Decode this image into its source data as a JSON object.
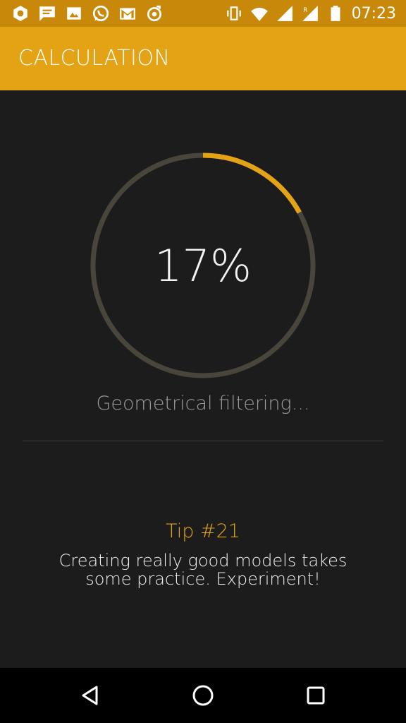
{
  "status_bar": {
    "time": "07:23",
    "notification_icons": [
      "shield-icon",
      "message-icon",
      "image-icon",
      "whatsapp-icon",
      "gmail-icon",
      "music-icon"
    ],
    "system_icons": [
      "vibrate-icon",
      "wifi-icon",
      "signal-icon",
      "roaming-signal-icon",
      "battery-icon"
    ]
  },
  "app_bar": {
    "title": "CALCULATION",
    "color": "#e3a315"
  },
  "progress": {
    "percent_label": "17%",
    "value": 0.17,
    "track_color": "#4a453c",
    "fill_color": "#e3a315"
  },
  "status": {
    "text": "Geometrical filtering..."
  },
  "tip": {
    "title": "Tip #21",
    "text": "Creating really good models takes some practice. Experiment!"
  },
  "nav_bar": {
    "buttons": [
      "back-icon",
      "home-icon",
      "recents-icon"
    ]
  }
}
